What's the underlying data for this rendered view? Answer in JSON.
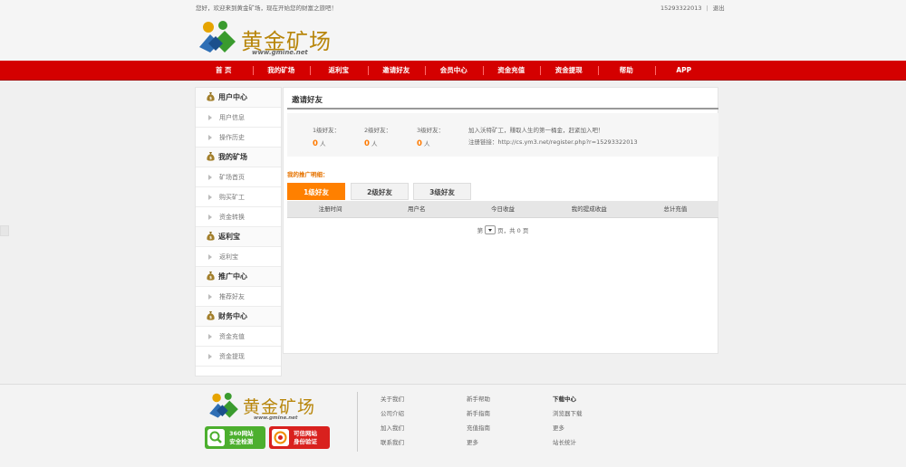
{
  "topbar": {
    "welcome": "您好，欢迎来到黄金矿场，现在开始您的财富之旅吧！",
    "account": "15293322013",
    "separator": "|",
    "logout": "退出"
  },
  "logo": {
    "brand": "黄金矿场",
    "url": "www.gmine.net"
  },
  "colors": {
    "nav_red": "#d40000",
    "accent_orange": "#ff8000",
    "gold": "#b8860b"
  },
  "nav": {
    "items": [
      "首 页",
      "我的矿场",
      "返利宝",
      "邀请好友",
      "会员中心",
      "资金充值",
      "资金提现",
      "帮助",
      "APP"
    ]
  },
  "sidebar": {
    "groups": [
      {
        "title": "用户中心",
        "icon": "money-bag-icon",
        "items": [
          "用户信息",
          "操作历史"
        ]
      },
      {
        "title": "我的矿场",
        "icon": "money-bag-icon",
        "items": [
          "矿场首页",
          "购买矿工",
          "资金转换"
        ]
      },
      {
        "title": "返利宝",
        "icon": "money-bag-icon",
        "items": [
          "返利宝"
        ]
      },
      {
        "title": "推广中心",
        "icon": "money-bag-icon",
        "items": [
          "推荐好友"
        ]
      },
      {
        "title": "财务中心",
        "icon": "money-bag-icon",
        "items": [
          "资金充值",
          "资金提现"
        ]
      }
    ]
  },
  "main": {
    "title": "邀请好友",
    "stats": [
      {
        "label": "1级好友：",
        "value": "0",
        "unit": "人"
      },
      {
        "label": "2级好友：",
        "value": "0",
        "unit": "人"
      },
      {
        "label": "3级好友：",
        "value": "0",
        "unit": "人"
      }
    ],
    "invite_text": "加入沃特矿工，赚取人生的第一桶金，赶紧加入吧！",
    "register_link": "注册链接：http://cs.ym3.net/register.php?r=15293322013",
    "sub_title": "我的推广明细：",
    "tabs": [
      "1级好友",
      "2级好友",
      "3级好友"
    ],
    "active_tab": 0,
    "table_headers": [
      "注册时间",
      "用户名",
      "今日收益",
      "我的提成收益",
      "总计充值"
    ],
    "pager": {
      "prefix": "第",
      "suffix": "页，共 0 页"
    }
  },
  "footer": {
    "brand": "黄金矿场",
    "url": "www.gmine.net",
    "badges": [
      {
        "line1": "360网站",
        "line2": "安全检测"
      },
      {
        "line1": "可信网站",
        "line2": "身份验证"
      }
    ],
    "col1": [
      "关于我们",
      "公司介绍",
      "加入我们",
      "联系我们"
    ],
    "col2": [
      "新手帮助",
      "新手指南",
      "充值指南",
      "更多"
    ],
    "col3": [
      "下载中心",
      "浏览器下载",
      "更多",
      "站长统计"
    ]
  }
}
